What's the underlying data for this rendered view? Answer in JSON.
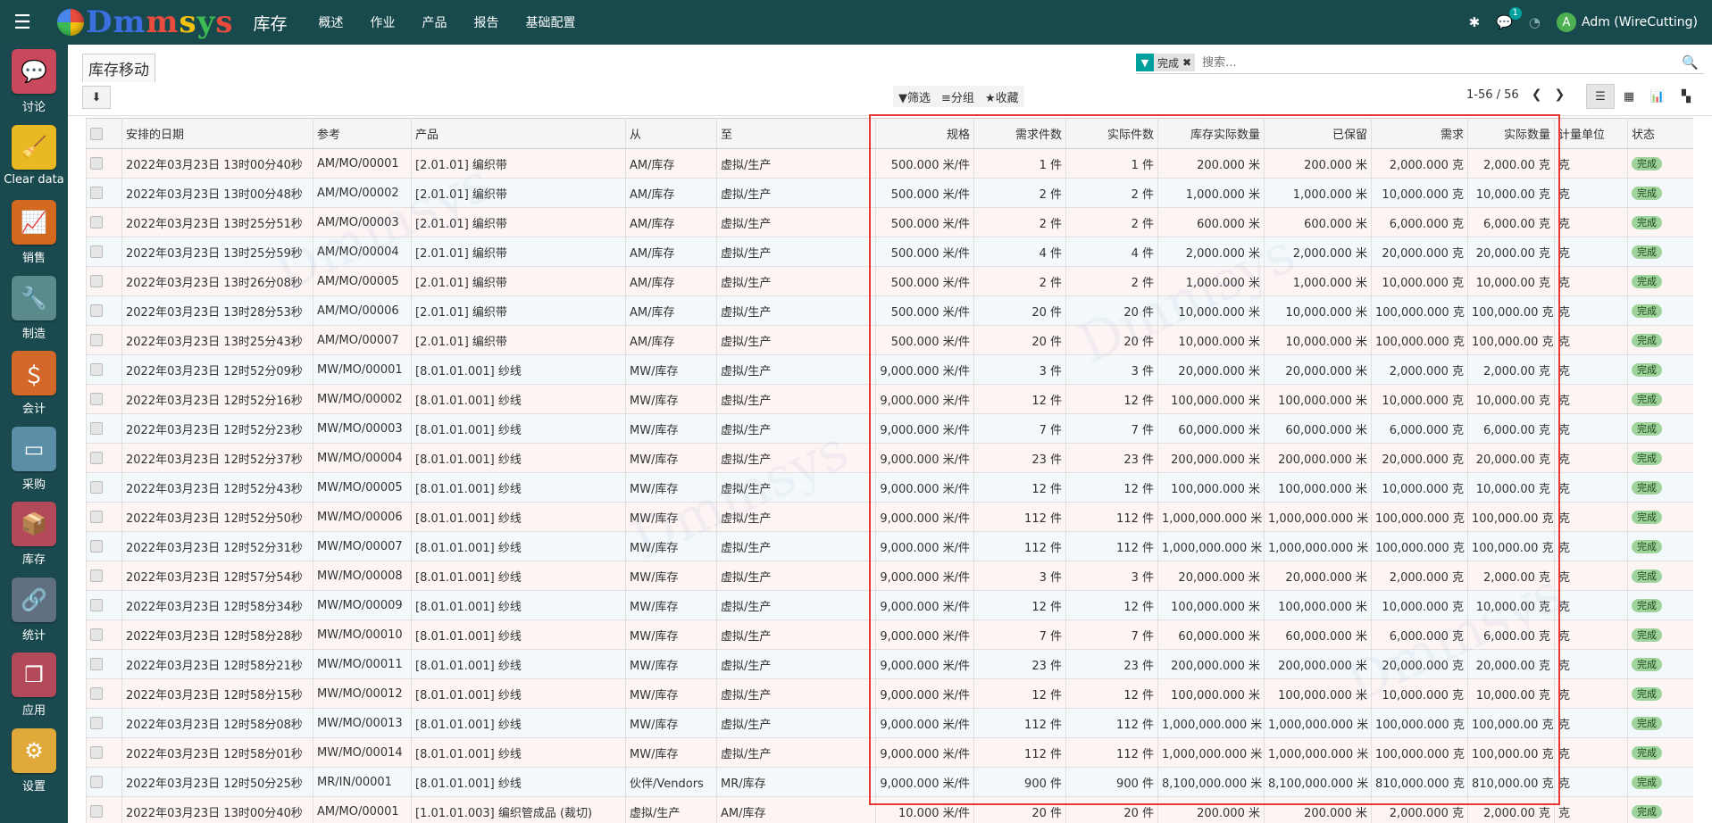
{
  "topbar": {
    "logo_text": "Dmmsys",
    "app_name": "库存",
    "menu": [
      "概述",
      "作业",
      "产品",
      "报告",
      "基础配置"
    ],
    "message_count": "1",
    "username": "Adm (WireCutting)",
    "avatar_letter": "A"
  },
  "sidebar": {
    "items": [
      {
        "label": "讨论",
        "icon": "chat-icon",
        "color": "#c9485b"
      },
      {
        "label": "Clear data",
        "icon": "broom-icon",
        "color": "#e8b923"
      },
      {
        "label": "销售",
        "icon": "chart-up-icon",
        "color": "#d2691e"
      },
      {
        "label": "制造",
        "icon": "wrench-icon",
        "color": "#5b8a8d"
      },
      {
        "label": "会计",
        "icon": "dollar-doc-icon",
        "color": "#d2692a"
      },
      {
        "label": "采购",
        "icon": "credit-card-icon",
        "color": "#5b8fa8"
      },
      {
        "label": "库存",
        "icon": "box-icon",
        "color": "#b24a5a"
      },
      {
        "label": "统计",
        "icon": "link-icon",
        "color": "#607080"
      },
      {
        "label": "应用",
        "icon": "cubes-icon",
        "color": "#b24a5a"
      },
      {
        "label": "设置",
        "icon": "gear-icon",
        "color": "#e0a93a"
      }
    ]
  },
  "control_panel": {
    "breadcrumb": "库存移动",
    "facet_value": "完成",
    "search_placeholder": "搜索...",
    "filter_label": "筛选",
    "group_label": "分组",
    "favorite_label": "收藏",
    "pager": "1-56 / 56"
  },
  "table": {
    "columns": [
      "安排的日期",
      "参考",
      "产品",
      "从",
      "至",
      "规格",
      "需求件数",
      "实际件数",
      "库存实际数量",
      "已保留",
      "需求",
      "实际数量",
      "计量单位",
      "状态"
    ],
    "rows": [
      [
        "2022年03月23日 13时00分40秒",
        "AM/MO/00001",
        "[2.01.01] 编织带",
        "AM/库存",
        "虚拟/生产",
        "500.000 米/件",
        "1 件",
        "1 件",
        "200.000 米",
        "200.000 米",
        "2,000.000 克",
        "2,000.00 克",
        "克",
        "完成"
      ],
      [
        "2022年03月23日 13时00分48秒",
        "AM/MO/00002",
        "[2.01.01] 编织带",
        "AM/库存",
        "虚拟/生产",
        "500.000 米/件",
        "2 件",
        "2 件",
        "1,000.000 米",
        "1,000.000 米",
        "10,000.000 克",
        "10,000.00 克",
        "克",
        "完成"
      ],
      [
        "2022年03月23日 13时25分51秒",
        "AM/MO/00003",
        "[2.01.01] 编织带",
        "AM/库存",
        "虚拟/生产",
        "500.000 米/件",
        "2 件",
        "2 件",
        "600.000 米",
        "600.000 米",
        "6,000.000 克",
        "6,000.00 克",
        "克",
        "完成"
      ],
      [
        "2022年03月23日 13时25分59秒",
        "AM/MO/00004",
        "[2.01.01] 编织带",
        "AM/库存",
        "虚拟/生产",
        "500.000 米/件",
        "4 件",
        "4 件",
        "2,000.000 米",
        "2,000.000 米",
        "20,000.000 克",
        "20,000.00 克",
        "克",
        "完成"
      ],
      [
        "2022年03月23日 13时26分08秒",
        "AM/MO/00005",
        "[2.01.01] 编织带",
        "AM/库存",
        "虚拟/生产",
        "500.000 米/件",
        "2 件",
        "2 件",
        "1,000.000 米",
        "1,000.000 米",
        "10,000.000 克",
        "10,000.00 克",
        "克",
        "完成"
      ],
      [
        "2022年03月23日 13时28分53秒",
        "AM/MO/00006",
        "[2.01.01] 编织带",
        "AM/库存",
        "虚拟/生产",
        "500.000 米/件",
        "20 件",
        "20 件",
        "10,000.000 米",
        "10,000.000 米",
        "100,000.000 克",
        "100,000.00 克",
        "克",
        "完成"
      ],
      [
        "2022年03月23日 13时25分43秒",
        "AM/MO/00007",
        "[2.01.01] 编织带",
        "AM/库存",
        "虚拟/生产",
        "500.000 米/件",
        "20 件",
        "20 件",
        "10,000.000 米",
        "10,000.000 米",
        "100,000.000 克",
        "100,000.00 克",
        "克",
        "完成"
      ],
      [
        "2022年03月23日 12时52分09秒",
        "MW/MO/00001",
        "[8.01.01.001] 纱线",
        "MW/库存",
        "虚拟/生产",
        "9,000.000 米/件",
        "3 件",
        "3 件",
        "20,000.000 米",
        "20,000.000 米",
        "2,000.000 克",
        "2,000.00 克",
        "克",
        "完成"
      ],
      [
        "2022年03月23日 12时52分16秒",
        "MW/MO/00002",
        "[8.01.01.001] 纱线",
        "MW/库存",
        "虚拟/生产",
        "9,000.000 米/件",
        "12 件",
        "12 件",
        "100,000.000 米",
        "100,000.000 米",
        "10,000.000 克",
        "10,000.00 克",
        "克",
        "完成"
      ],
      [
        "2022年03月23日 12时52分23秒",
        "MW/MO/00003",
        "[8.01.01.001] 纱线",
        "MW/库存",
        "虚拟/生产",
        "9,000.000 米/件",
        "7 件",
        "7 件",
        "60,000.000 米",
        "60,000.000 米",
        "6,000.000 克",
        "6,000.00 克",
        "克",
        "完成"
      ],
      [
        "2022年03月23日 12时52分37秒",
        "MW/MO/00004",
        "[8.01.01.001] 纱线",
        "MW/库存",
        "虚拟/生产",
        "9,000.000 米/件",
        "23 件",
        "23 件",
        "200,000.000 米",
        "200,000.000 米",
        "20,000.000 克",
        "20,000.00 克",
        "克",
        "完成"
      ],
      [
        "2022年03月23日 12时52分43秒",
        "MW/MO/00005",
        "[8.01.01.001] 纱线",
        "MW/库存",
        "虚拟/生产",
        "9,000.000 米/件",
        "12 件",
        "12 件",
        "100,000.000 米",
        "100,000.000 米",
        "10,000.000 克",
        "10,000.00 克",
        "克",
        "完成"
      ],
      [
        "2022年03月23日 12时52分50秒",
        "MW/MO/00006",
        "[8.01.01.001] 纱线",
        "MW/库存",
        "虚拟/生产",
        "9,000.000 米/件",
        "112 件",
        "112 件",
        "1,000,000.000 米",
        "1,000,000.000 米",
        "100,000.000 克",
        "100,000.00 克",
        "克",
        "完成"
      ],
      [
        "2022年03月23日 12时52分31秒",
        "MW/MO/00007",
        "[8.01.01.001] 纱线",
        "MW/库存",
        "虚拟/生产",
        "9,000.000 米/件",
        "112 件",
        "112 件",
        "1,000,000.000 米",
        "1,000,000.000 米",
        "100,000.000 克",
        "100,000.00 克",
        "克",
        "完成"
      ],
      [
        "2022年03月23日 12时57分54秒",
        "MW/MO/00008",
        "[8.01.01.001] 纱线",
        "MW/库存",
        "虚拟/生产",
        "9,000.000 米/件",
        "3 件",
        "3 件",
        "20,000.000 米",
        "20,000.000 米",
        "2,000.000 克",
        "2,000.00 克",
        "克",
        "完成"
      ],
      [
        "2022年03月23日 12时58分34秒",
        "MW/MO/00009",
        "[8.01.01.001] 纱线",
        "MW/库存",
        "虚拟/生产",
        "9,000.000 米/件",
        "12 件",
        "12 件",
        "100,000.000 米",
        "100,000.000 米",
        "10,000.000 克",
        "10,000.00 克",
        "克",
        "完成"
      ],
      [
        "2022年03月23日 12时58分28秒",
        "MW/MO/00010",
        "[8.01.01.001] 纱线",
        "MW/库存",
        "虚拟/生产",
        "9,000.000 米/件",
        "7 件",
        "7 件",
        "60,000.000 米",
        "60,000.000 米",
        "6,000.000 克",
        "6,000.00 克",
        "克",
        "完成"
      ],
      [
        "2022年03月23日 12时58分21秒",
        "MW/MO/00011",
        "[8.01.01.001] 纱线",
        "MW/库存",
        "虚拟/生产",
        "9,000.000 米/件",
        "23 件",
        "23 件",
        "200,000.000 米",
        "200,000.000 米",
        "20,000.000 克",
        "20,000.00 克",
        "克",
        "完成"
      ],
      [
        "2022年03月23日 12时58分15秒",
        "MW/MO/00012",
        "[8.01.01.001] 纱线",
        "MW/库存",
        "虚拟/生产",
        "9,000.000 米/件",
        "12 件",
        "12 件",
        "100,000.000 米",
        "100,000.000 米",
        "10,000.000 克",
        "10,000.00 克",
        "克",
        "完成"
      ],
      [
        "2022年03月23日 12时58分08秒",
        "MW/MO/00013",
        "[8.01.01.001] 纱线",
        "MW/库存",
        "虚拟/生产",
        "9,000.000 米/件",
        "112 件",
        "112 件",
        "1,000,000.000 米",
        "1,000,000.000 米",
        "100,000.000 克",
        "100,000.00 克",
        "克",
        "完成"
      ],
      [
        "2022年03月23日 12时58分01秒",
        "MW/MO/00014",
        "[8.01.01.001] 纱线",
        "MW/库存",
        "虚拟/生产",
        "9,000.000 米/件",
        "112 件",
        "112 件",
        "1,000,000.000 米",
        "1,000,000.000 米",
        "100,000.000 克",
        "100,000.00 克",
        "克",
        "完成"
      ],
      [
        "2022年03月23日 12时50分25秒",
        "MR/IN/00001",
        "[8.01.01.001] 纱线",
        "伙伴/Vendors",
        "MR/库存",
        "9,000.000 米/件",
        "900 件",
        "900 件",
        "8,100,000.000 米",
        "8,100,000.000 米",
        "810,000.000 克",
        "810,000.00 克",
        "克",
        "完成"
      ],
      [
        "2022年03月23日 13时00分40秒",
        "AM/MO/00001",
        "[1.01.01.003] 编织管成品 (裁切)",
        "虚拟/生产",
        "AM/库存",
        "10.000 米/件",
        "20 件",
        "20 件",
        "200.000 米",
        "200.000 米",
        "2,000.000 克",
        "2,000.00 克",
        "克",
        "完成"
      ]
    ]
  },
  "colors": {
    "topbar": "#17494d",
    "sidebar": "#1a4a4f",
    "accent": "#00a09d",
    "highlight_box": "#e53935",
    "state_badge": "#9ed49b"
  }
}
